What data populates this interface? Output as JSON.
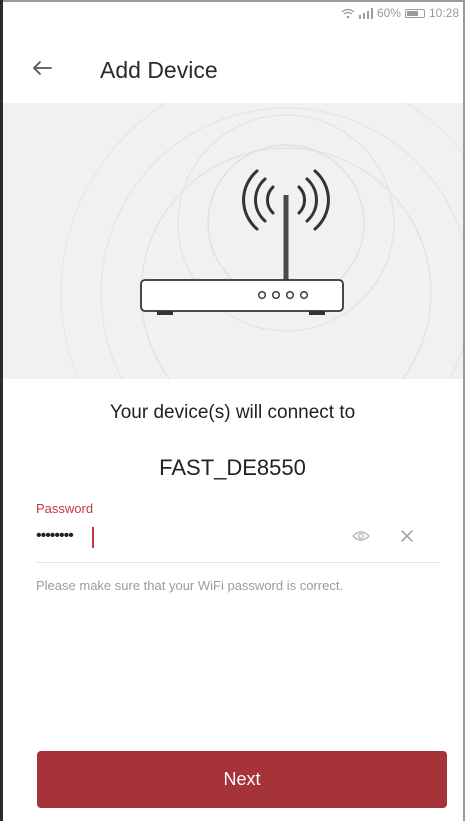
{
  "status_bar": {
    "battery_percent": "60%",
    "time": "10:28"
  },
  "header": {
    "back_icon": "arrow-left-icon",
    "title": "Add Device"
  },
  "hero": {
    "illustration": "router-wifi-icon"
  },
  "main": {
    "connect_text": "Your device(s) will connect to",
    "network_name": "FAST_DE8550"
  },
  "password": {
    "label": "Password",
    "masked_value": "••••••••",
    "visibility_icon": "eye-icon",
    "clear_icon": "close-icon",
    "hint": "Please make sure that your WiFi password is correct."
  },
  "actions": {
    "next_label": "Next"
  },
  "colors": {
    "accent": "#a7333a",
    "label_accent": "#c0394a",
    "hero_background": "#f1f1f1",
    "hint_text": "#9c9c9c"
  }
}
